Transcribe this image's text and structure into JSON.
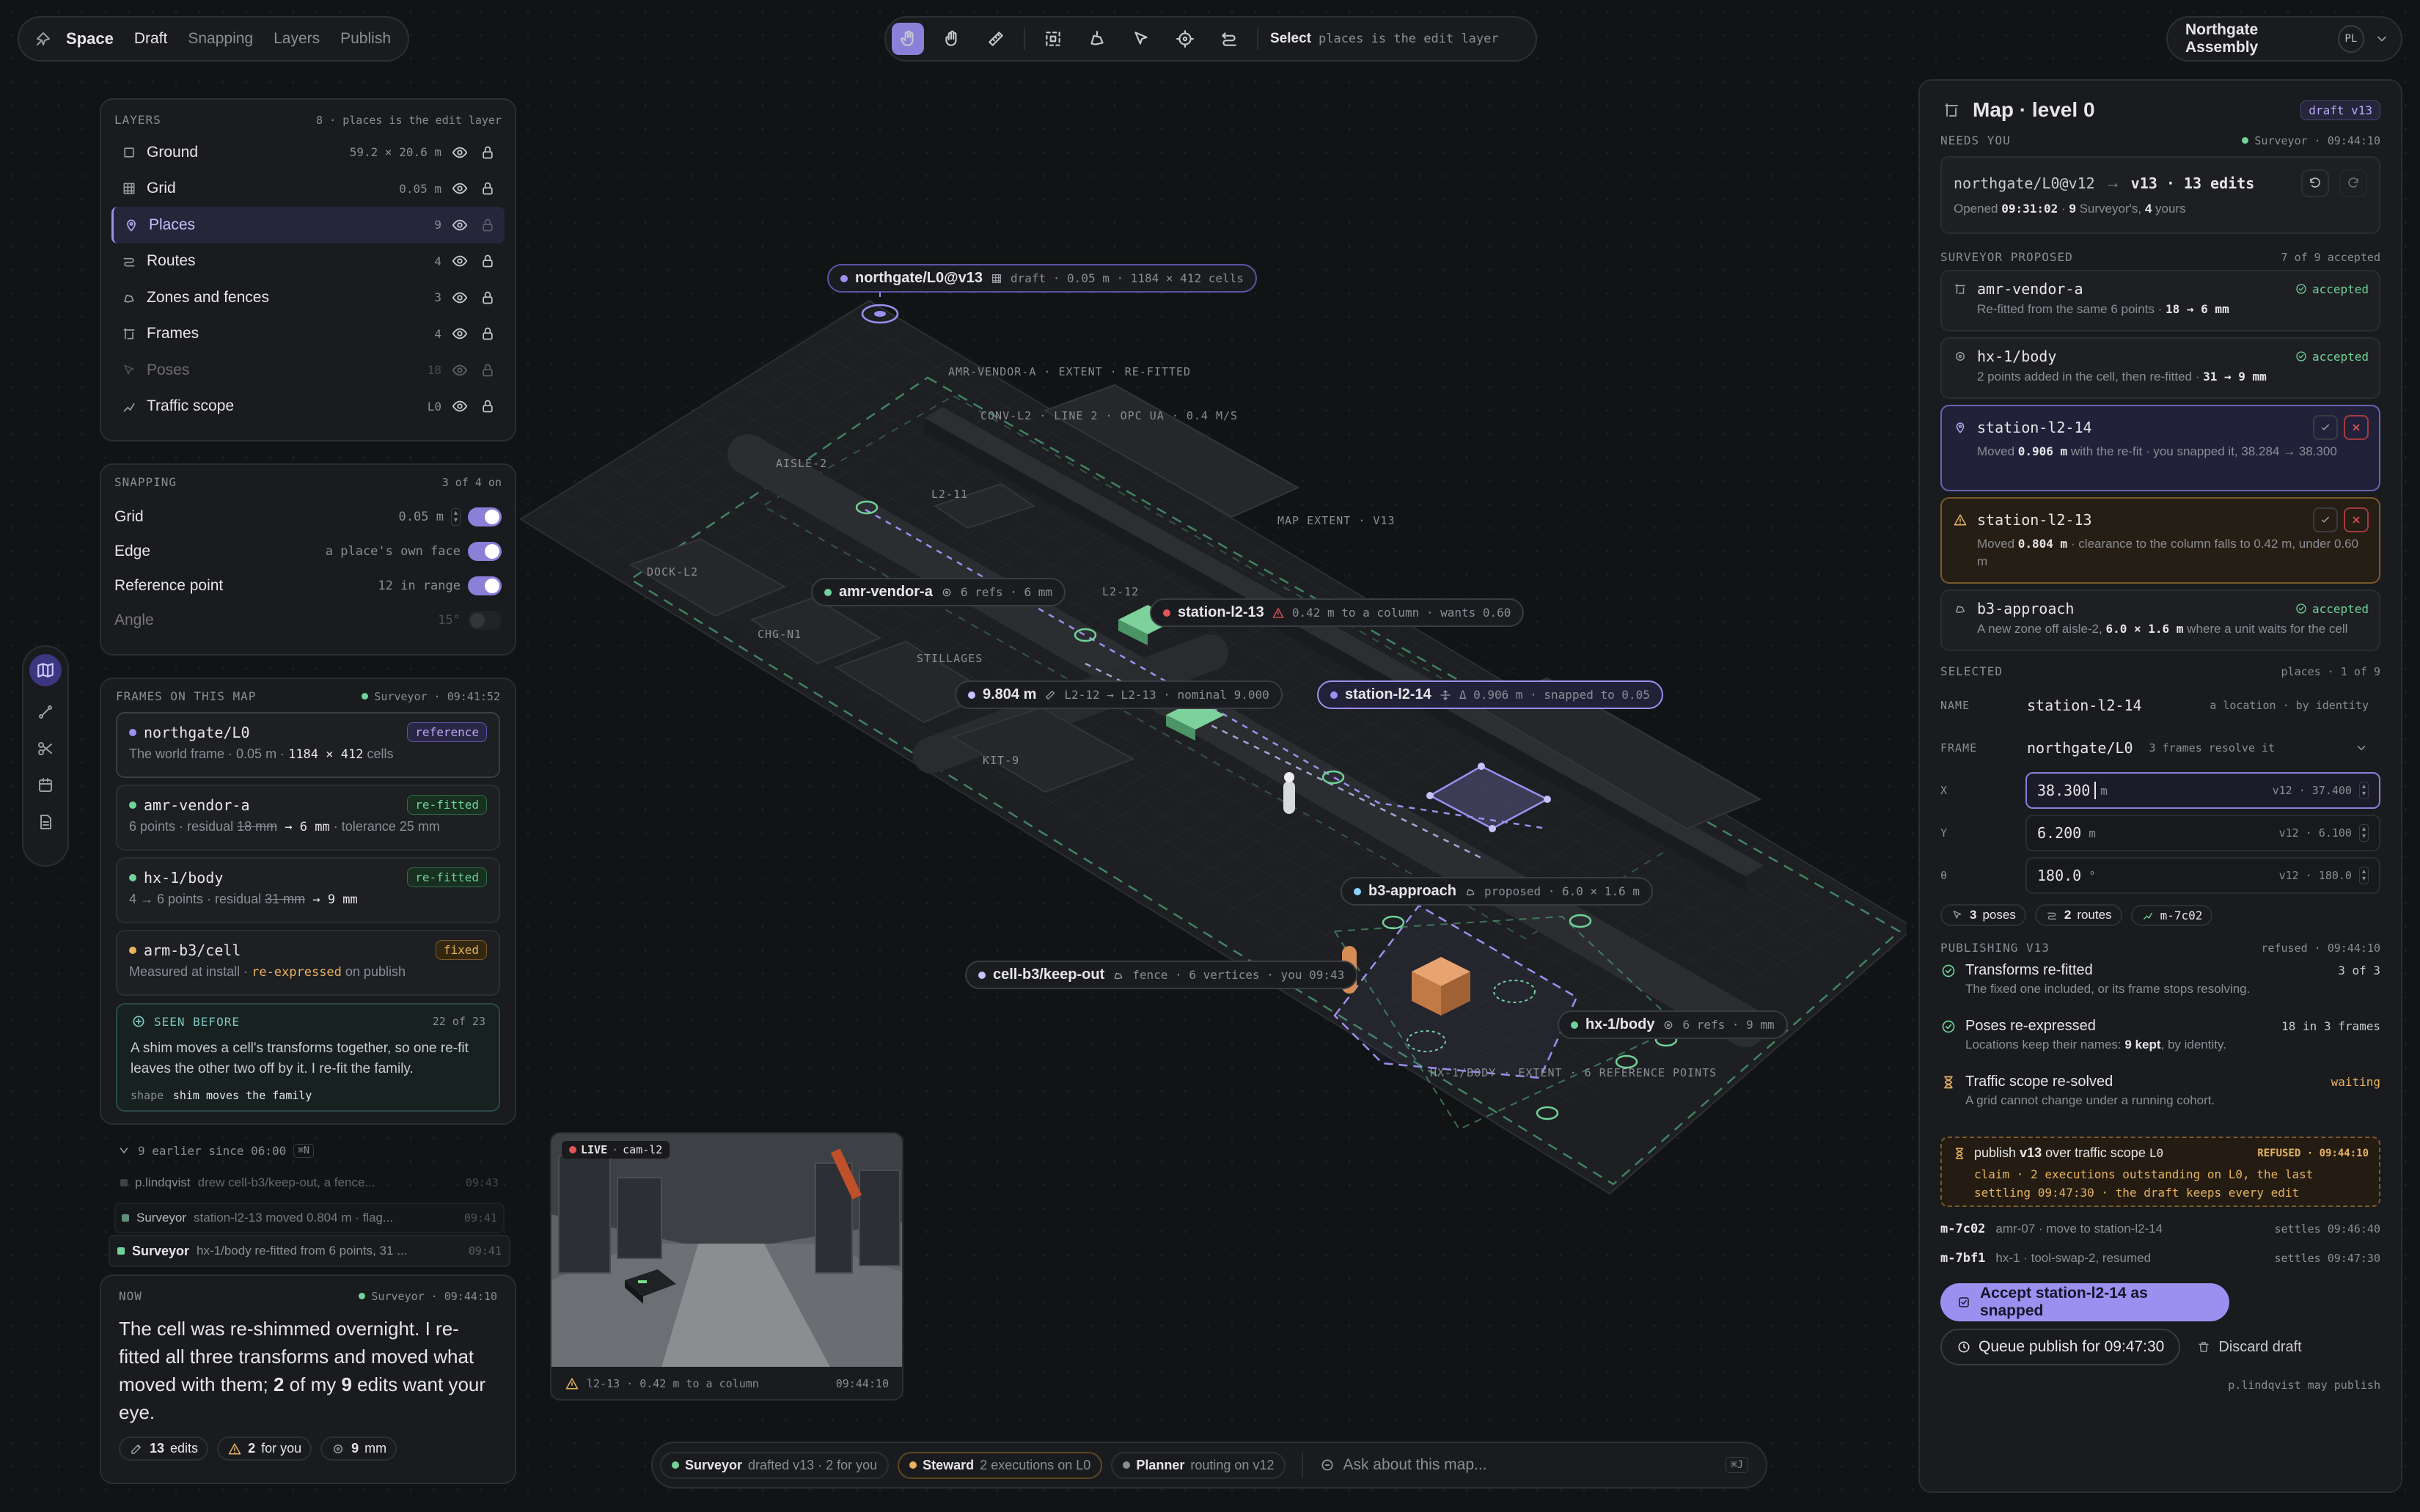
{
  "nav": {
    "brand": "Space",
    "items": [
      "Draft",
      "Snapping",
      "Layers",
      "Publish"
    ]
  },
  "toolbar": {
    "status_strong": "Select",
    "status_text": "places is the edit layer"
  },
  "workspace": {
    "name": "Northgate Assembly",
    "initials": "PL"
  },
  "layers": {
    "title": "LAYERS",
    "meta": "8 · places is the edit layer",
    "items": [
      {
        "label": "Ground",
        "value": "59.2 × 20.6 m",
        "icon": "square-icon"
      },
      {
        "label": "Grid",
        "value": "0.05 m",
        "icon": "grid-icon"
      },
      {
        "label": "Places",
        "value": "9",
        "icon": "pin-icon"
      },
      {
        "label": "Routes",
        "value": "4",
        "icon": "route-icon"
      },
      {
        "label": "Zones and fences",
        "value": "3",
        "icon": "fence-icon"
      },
      {
        "label": "Frames",
        "value": "4",
        "icon": "frame-icon"
      },
      {
        "label": "Poses",
        "value": "18",
        "icon": "pose-icon"
      },
      {
        "label": "Traffic scope",
        "value": "L0",
        "icon": "traffic-icon"
      }
    ]
  },
  "snapping": {
    "title": "SNAPPING",
    "meta": "3 of 4 on",
    "items": [
      {
        "label": "Grid",
        "value": "0.05 m"
      },
      {
        "label": "Edge",
        "value": "a place's own face"
      },
      {
        "label": "Reference point",
        "value": "12 in range"
      },
      {
        "label": "Angle",
        "value": "15°"
      }
    ]
  },
  "frames": {
    "title": "FRAMES ON THIS MAP",
    "agent": "Surveyor · 09:41:52",
    "items": [
      {
        "name": "northgate/L0",
        "badge": "reference",
        "desc_a": "The world frame · 0.05 m · ",
        "desc_b": "1184 × 412",
        "desc_c": " cells",
        "color": "#9d8ff0"
      },
      {
        "name": "amr-vendor-a",
        "badge": "re-fitted",
        "desc_a": "6 points · residual ",
        "desc_strike": "18 mm",
        "desc_b": " → 6 mm",
        "desc_c": " · tolerance 25 mm",
        "color": "#6fd39a"
      },
      {
        "name": "hx-1/body",
        "badge": "re-fitted",
        "desc_a": "4 → 6 points · residual ",
        "desc_strike": "31 mm",
        "desc_b": " → 9 mm",
        "desc_c": "",
        "color": "#6fd39a"
      },
      {
        "name": "arm-b3/cell",
        "badge": "fixed",
        "desc_a": "Measured at install · ",
        "desc_b": "re-expressed",
        "desc_c": " on publish",
        "color": "#e7b35f"
      }
    ],
    "seen": {
      "title": "SEEN BEFORE",
      "count": "22 of 23",
      "text": "A shim moves a cell's transforms together, so one re-fit leaves the other two off by it. I re-fit the family.",
      "shape_label": "shape",
      "shape_value": "shim moves the family"
    }
  },
  "history": {
    "earlier": "9 earlier since 06:00",
    "kbd": "⌘N",
    "items": [
      {
        "who": "p.lindqvist",
        "text": "drew cell-b3/keep-out, a fence...",
        "time": "09:43"
      },
      {
        "who": "Surveyor",
        "text": "station-l2-13 moved 0.804 m · flag...",
        "time": "09:41"
      },
      {
        "who": "Surveyor",
        "text": "hx-1/body re-fitted from 6 points, 31 ...",
        "time": "09:41"
      }
    ]
  },
  "now": {
    "title": "NOW",
    "agent": "Surveyor · 09:44:10",
    "text_a": "The cell was re-shimmed overnight. I re-fitted all three transforms and moved what moved with them; ",
    "text_b": "2",
    "text_c": " of my ",
    "text_d": "9",
    "text_e": " edits want your eye.",
    "chips": [
      {
        "strong": "13",
        "text": "edits",
        "icon": "edit-icon"
      },
      {
        "strong": "2",
        "text": "for you",
        "icon": "warning-icon"
      },
      {
        "strong": "9",
        "text": "mm",
        "icon": "target-icon"
      }
    ]
  },
  "camera": {
    "live": "LIVE",
    "name": "cam-l2",
    "caption": "l2-13 · 0.42 m to a column",
    "time": "09:44:10"
  },
  "map_labels": {
    "version": {
      "name": "northgate/L0@v13",
      "meta": "draft · 0.05 m · 1184 × 412 cells"
    },
    "amr": {
      "name": "amr-vendor-a",
      "meta": "6 refs · 6 mm"
    },
    "st13": {
      "name": "station-l2-13",
      "meta": "0.42 m to a column · wants 0.60"
    },
    "dist": {
      "name": "9.804 m",
      "meta": "L2-12 → L2-13 · nominal 9.000"
    },
    "st14": {
      "name": "station-l2-14",
      "meta": "Δ 0.906 m · snapped to 0.05"
    },
    "b3": {
      "name": "b3-approach",
      "meta": "proposed · 6.0 × 1.6 m"
    },
    "cell": {
      "name": "cell-b3/keep-out",
      "meta": "fence · 6 vertices · you 09:43"
    },
    "hx": {
      "name": "hx-1/body",
      "meta": "6 refs · 9 mm"
    },
    "floor": [
      "AMR-VENDOR-A · EXTENT · RE-FITTED",
      "CONV-L2 · LINE 2 · OPC UA · 0.4 M/S",
      "AISLE-2",
      "L2-11",
      "MAP EXTENT · V13",
      "DOCK-L2",
      "L2-12",
      "CHG-N1",
      "STILLAGES",
      "KIT-9",
      "HX-1/BODY · EXTENT · 6 REFERENCE POINTS"
    ]
  },
  "bottom_bar": {
    "agents": [
      {
        "name": "Surveyor",
        "text": "drafted v13 · 2 for you",
        "color": "#6fd39a"
      },
      {
        "name": "Steward",
        "text": "2 executions on L0",
        "color": "#e7b35f"
      },
      {
        "name": "Planner",
        "text": "routing on v12",
        "color": "#8b8d94"
      }
    ],
    "ask_placeholder": "Ask about this map...",
    "ask_kbd": "⌘J"
  },
  "right": {
    "title": "Map · level 0",
    "version_badge": "draft v13",
    "needs_you": "NEEDS YOU",
    "needs_agent": "Surveyor · 09:44:10",
    "diff": {
      "from": "northgate/L0@v12",
      "to": "v13 · 13 edits",
      "opened_label": "Opened",
      "opened_time": "09:31:02",
      "sep": " · ",
      "count": "9",
      "by": " Surveyor's, ",
      "yours": "4",
      "yours_label": " yours"
    },
    "proposed_title": "SURVEYOR PROPOSED",
    "proposed_meta": "7 of 9 accepted",
    "proposals": [
      {
        "name": "amr-vendor-a",
        "state": "accepted",
        "desc": "Re-fitted from the same 6 points · ",
        "desc_b": "18 → 6 mm",
        "desc_c": "",
        "kind": "ok",
        "icon": "frame-icon"
      },
      {
        "name": "hx-1/body",
        "state": "accepted",
        "desc": "2 points added in the cell, then re-fitted · ",
        "desc_b": "31 → 9 mm",
        "desc_c": "",
        "kind": "ok",
        "icon": "target-icon"
      },
      {
        "name": "station-l2-14",
        "state": "",
        "desc": "Moved ",
        "desc_b": "0.906 m",
        "desc_c": " with the re-fit · you snapped it, 38.284 → 38.300",
        "kind": "sel",
        "icon": "pin-icon"
      },
      {
        "name": "station-l2-13",
        "state": "",
        "desc": "Moved ",
        "desc_b": "0.804 m",
        "desc_c": " · clearance to the column falls to 0.42 m, under 0.60 m",
        "kind": "warn",
        "icon": "warning-icon"
      },
      {
        "name": "b3-approach",
        "state": "accepted",
        "desc": "A new zone off aisle-2, ",
        "desc_b": "6.0 × 1.6 m",
        "desc_c": " where a unit waits for the cell",
        "kind": "ok",
        "icon": "fence-icon"
      }
    ],
    "selected_title": "SELECTED",
    "selected_meta": "places · 1 of 9",
    "fields": {
      "name_label": "NAME",
      "name_value": "station-l2-14",
      "name_hint": "a location · by identity",
      "frame_label": "FRAME",
      "frame_value": "northgate/L0",
      "frame_hint": "3 frames resolve it",
      "x_label": "X",
      "x_value": "38.300",
      "x_unit": "m",
      "x_prev": "v12 · 37.400",
      "y_label": "Y",
      "y_value": "6.200",
      "y_unit": "m",
      "y_prev": "v12 · 6.100",
      "t_label": "θ",
      "t_value": "180.0",
      "t_unit": "°",
      "t_prev": "v12 · 180.0"
    },
    "refs": [
      {
        "strong": "3",
        "text": "poses",
        "icon": "pose-icon"
      },
      {
        "strong": "2",
        "text": "routes",
        "icon": "route-icon"
      },
      {
        "strong": "",
        "text": "m-7c02",
        "icon": "traffic-icon"
      }
    ],
    "publishing_title": "PUBLISHING V13",
    "publishing_meta": "refused · 09:44:10",
    "checks": [
      {
        "title": "Transforms re-fitted",
        "desc": "The fixed one included, or its frame stops resolving.",
        "desc_b": "",
        "desc_c": "",
        "value": "3 of 3",
        "state": "ok"
      },
      {
        "title": "Poses re-expressed",
        "desc": "Locations keep their names: ",
        "desc_b": "9 kept",
        "desc_c": ", by identity.",
        "value": "18 in 3 frames",
        "state": "ok"
      },
      {
        "title": "Traffic scope re-solved",
        "desc": "A grid cannot change under a running cohort.",
        "desc_b": "",
        "desc_c": "",
        "value": "waiting",
        "state": "wait"
      }
    ],
    "refused": {
      "title_a": "publish ",
      "title_b": "v13",
      "title_c": " over traffic scope ",
      "title_d": "L0",
      "tag": "REFUSED · 09:44:10",
      "text": "claim · 2 executions outstanding on L0, the last settling 09:47:30 · the draft keeps every edit"
    },
    "executions": [
      {
        "id": "m-7c02",
        "text": "amr-07 · move to station-l2-14",
        "time": "settles 09:46:40"
      },
      {
        "id": "m-7bf1",
        "text": "hx-1 · tool-swap-2, resumed",
        "time": "settles 09:47:30"
      }
    ],
    "accept_label": "Accept station-l2-14 as snapped",
    "queue_label": "Queue publish for 09:47:30",
    "discard_label": "Discard draft",
    "footer": "p.lindqvist may publish"
  },
  "colors": {
    "accent": "#8b7fd8",
    "ok": "#6fd39a",
    "warn": "#e7b35f",
    "danger": "#e2555a"
  }
}
